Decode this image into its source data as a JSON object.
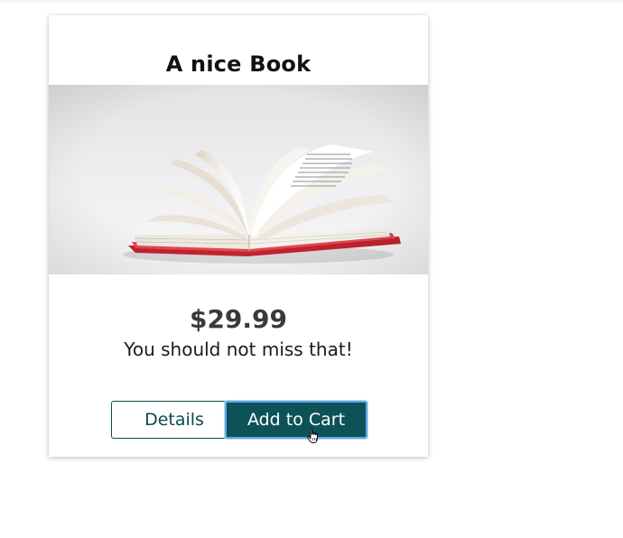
{
  "product": {
    "title": "A nice Book",
    "image": "open-book-photo",
    "price": "$29.99",
    "description": "You should not miss that!"
  },
  "actions": {
    "details_label": "Details",
    "add_to_cart_label": "Add to Cart"
  },
  "colors": {
    "primary": "#0d5257",
    "focus_ring": "#62a8e8",
    "page_background": "#ffffff"
  },
  "cursor": "hand-pointer-icon"
}
